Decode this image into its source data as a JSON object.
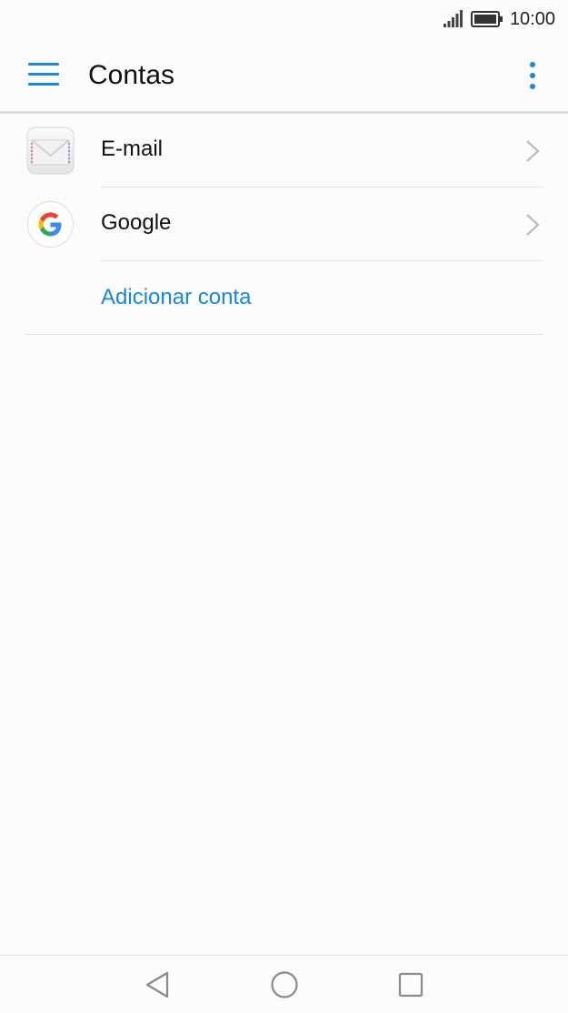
{
  "status_bar": {
    "time": "10:00",
    "signal_icon": "signal-icon",
    "battery_icon": "battery-icon"
  },
  "app_bar": {
    "title": "Contas",
    "menu_icon": "hamburger-menu-icon",
    "more_icon": "more-vert-icon"
  },
  "accounts": [
    {
      "label": "E-mail",
      "icon": "email-envelope-icon"
    },
    {
      "label": "Google",
      "icon": "google-icon"
    }
  ],
  "add_account_label": "Adicionar conta",
  "nav_bar": {
    "back_icon": "back-icon",
    "home_icon": "home-icon",
    "recents_icon": "recents-icon"
  },
  "colors": {
    "accent": "#1a87d9",
    "background": "#fcfcfc",
    "divider": "#e3e3e3"
  }
}
